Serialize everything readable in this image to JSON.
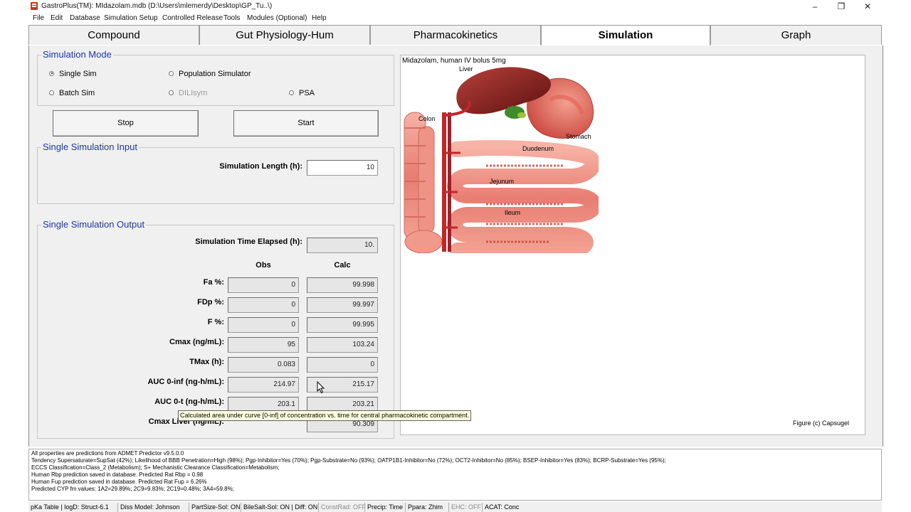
{
  "window": {
    "title": "GastroPlus(TM): MIdazolam.mdb (D:\\Users\\mlemerdy\\Desktop\\GP_Tu..\\)",
    "minimize_glyph": "–",
    "restore_glyph": "❐",
    "close_glyph": "✕"
  },
  "menu": [
    "File",
    "Edit",
    "Database",
    "Simulation Setup",
    "Controlled Release",
    "Tools",
    "Modules (Optional)",
    "Help"
  ],
  "tabs": [
    "Compound",
    "Gut Physiology-Hum",
    "Pharmacokinetics",
    "Simulation",
    "Graph"
  ],
  "active_tab": "Simulation",
  "simulation_mode": {
    "title": "Simulation Mode",
    "options": {
      "single_sim": "Single Sim",
      "population_simulator": "Population Simulator",
      "batch_sim": "Batch Sim",
      "diliisym": "DILIsym",
      "psa": "PSA"
    },
    "selected": "Single Sim"
  },
  "buttons": {
    "stop": "Stop",
    "start": "Start"
  },
  "single_input": {
    "title": "Single Simulation Input",
    "sim_length_label": "Simulation Length  (h):",
    "sim_length_value": "10"
  },
  "single_output": {
    "title": "Single Simulation Output",
    "elapsed_label": "Simulation Time Elapsed (h):",
    "elapsed_value": "10.",
    "obs_header": "Obs",
    "calc_header": "Calc",
    "rows": [
      {
        "label": "Fa %:",
        "obs": "0",
        "calc": "99.998"
      },
      {
        "label": "FDp %:",
        "obs": "0",
        "calc": "99.997"
      },
      {
        "label": "F %:",
        "obs": "0",
        "calc": "99.995"
      },
      {
        "label": "Cmax (ng/mL):",
        "obs": "95",
        "calc": "103.24"
      },
      {
        "label": "TMax (h):",
        "obs": "0.083",
        "calc": "0"
      },
      {
        "label": "AUC 0-inf (ng-h/mL):",
        "obs": "214.97",
        "calc": "215.17"
      },
      {
        "label": "AUC 0-t (ng-h/mL):",
        "obs": "203.1",
        "calc": "203.21"
      },
      {
        "label": "Cmax Liver (ng/mL):",
        "obs": "",
        "calc": "90.309"
      }
    ]
  },
  "tooltip": "Calculated area under curve [0-inf] of concentration vs. time for central pharmacokinetic compartment.",
  "figure": {
    "title": "Midazolam, human IV bolus 5mg",
    "credit": "Figure (c) Capsugel",
    "labels": {
      "liver": "Liver",
      "colon": "Colon",
      "stomach": "Stomach",
      "duodenum": "Duodenum",
      "jejunum": "Jejunum",
      "ileum": "Ileum"
    }
  },
  "info_lines": [
    "All properties are predictions from ADMET Predictor v9.5.0.0",
    "Tendency Supersaturate=SupSat (42%); Likelihood of BBB Penetration=High (98%); Pgp-Inhibitor=Yes (70%); Pgp-Substrate=No (93%); OATP1B1-Inhibitor=No (72%); OCT2-Inhibitor=No (85%); BSEP-Inhibitor=Yes (83%); BCRP-Substrate=Yes (95%);",
    "ECCS Classification=Class_2 (Metabolism); S+ Mechanistic Clearance Classification=Metabolism;",
    "Human Rbp prediction saved in database. Predicted Rat Rbp = 0.98",
    "Human Fup prediction saved in database. Predicted Rat Fup = 6.26%",
    "Predicted CYP fm values: 1A2=29.89%; 2C9=9.83%; 2C19=0.48%; 3A4=59.8%;"
  ],
  "status": [
    {
      "text": "pKa Table | logD: Struct-6.1",
      "dim": false
    },
    {
      "text": "Diss Model: Johnson",
      "dim": false
    },
    {
      "text": "PartSize-Sol: ON",
      "dim": false
    },
    {
      "text": "BileSalt-Sol: ON | Diff: ON",
      "dim": false
    },
    {
      "text": "ConstRad: OFF",
      "dim": true
    },
    {
      "text": "Precip: Time",
      "dim": false
    },
    {
      "text": "Ppara: Zhim",
      "dim": false
    },
    {
      "text": "EHC: OFF",
      "dim": true
    },
    {
      "text": "ACAT: Conc",
      "dim": false
    }
  ]
}
